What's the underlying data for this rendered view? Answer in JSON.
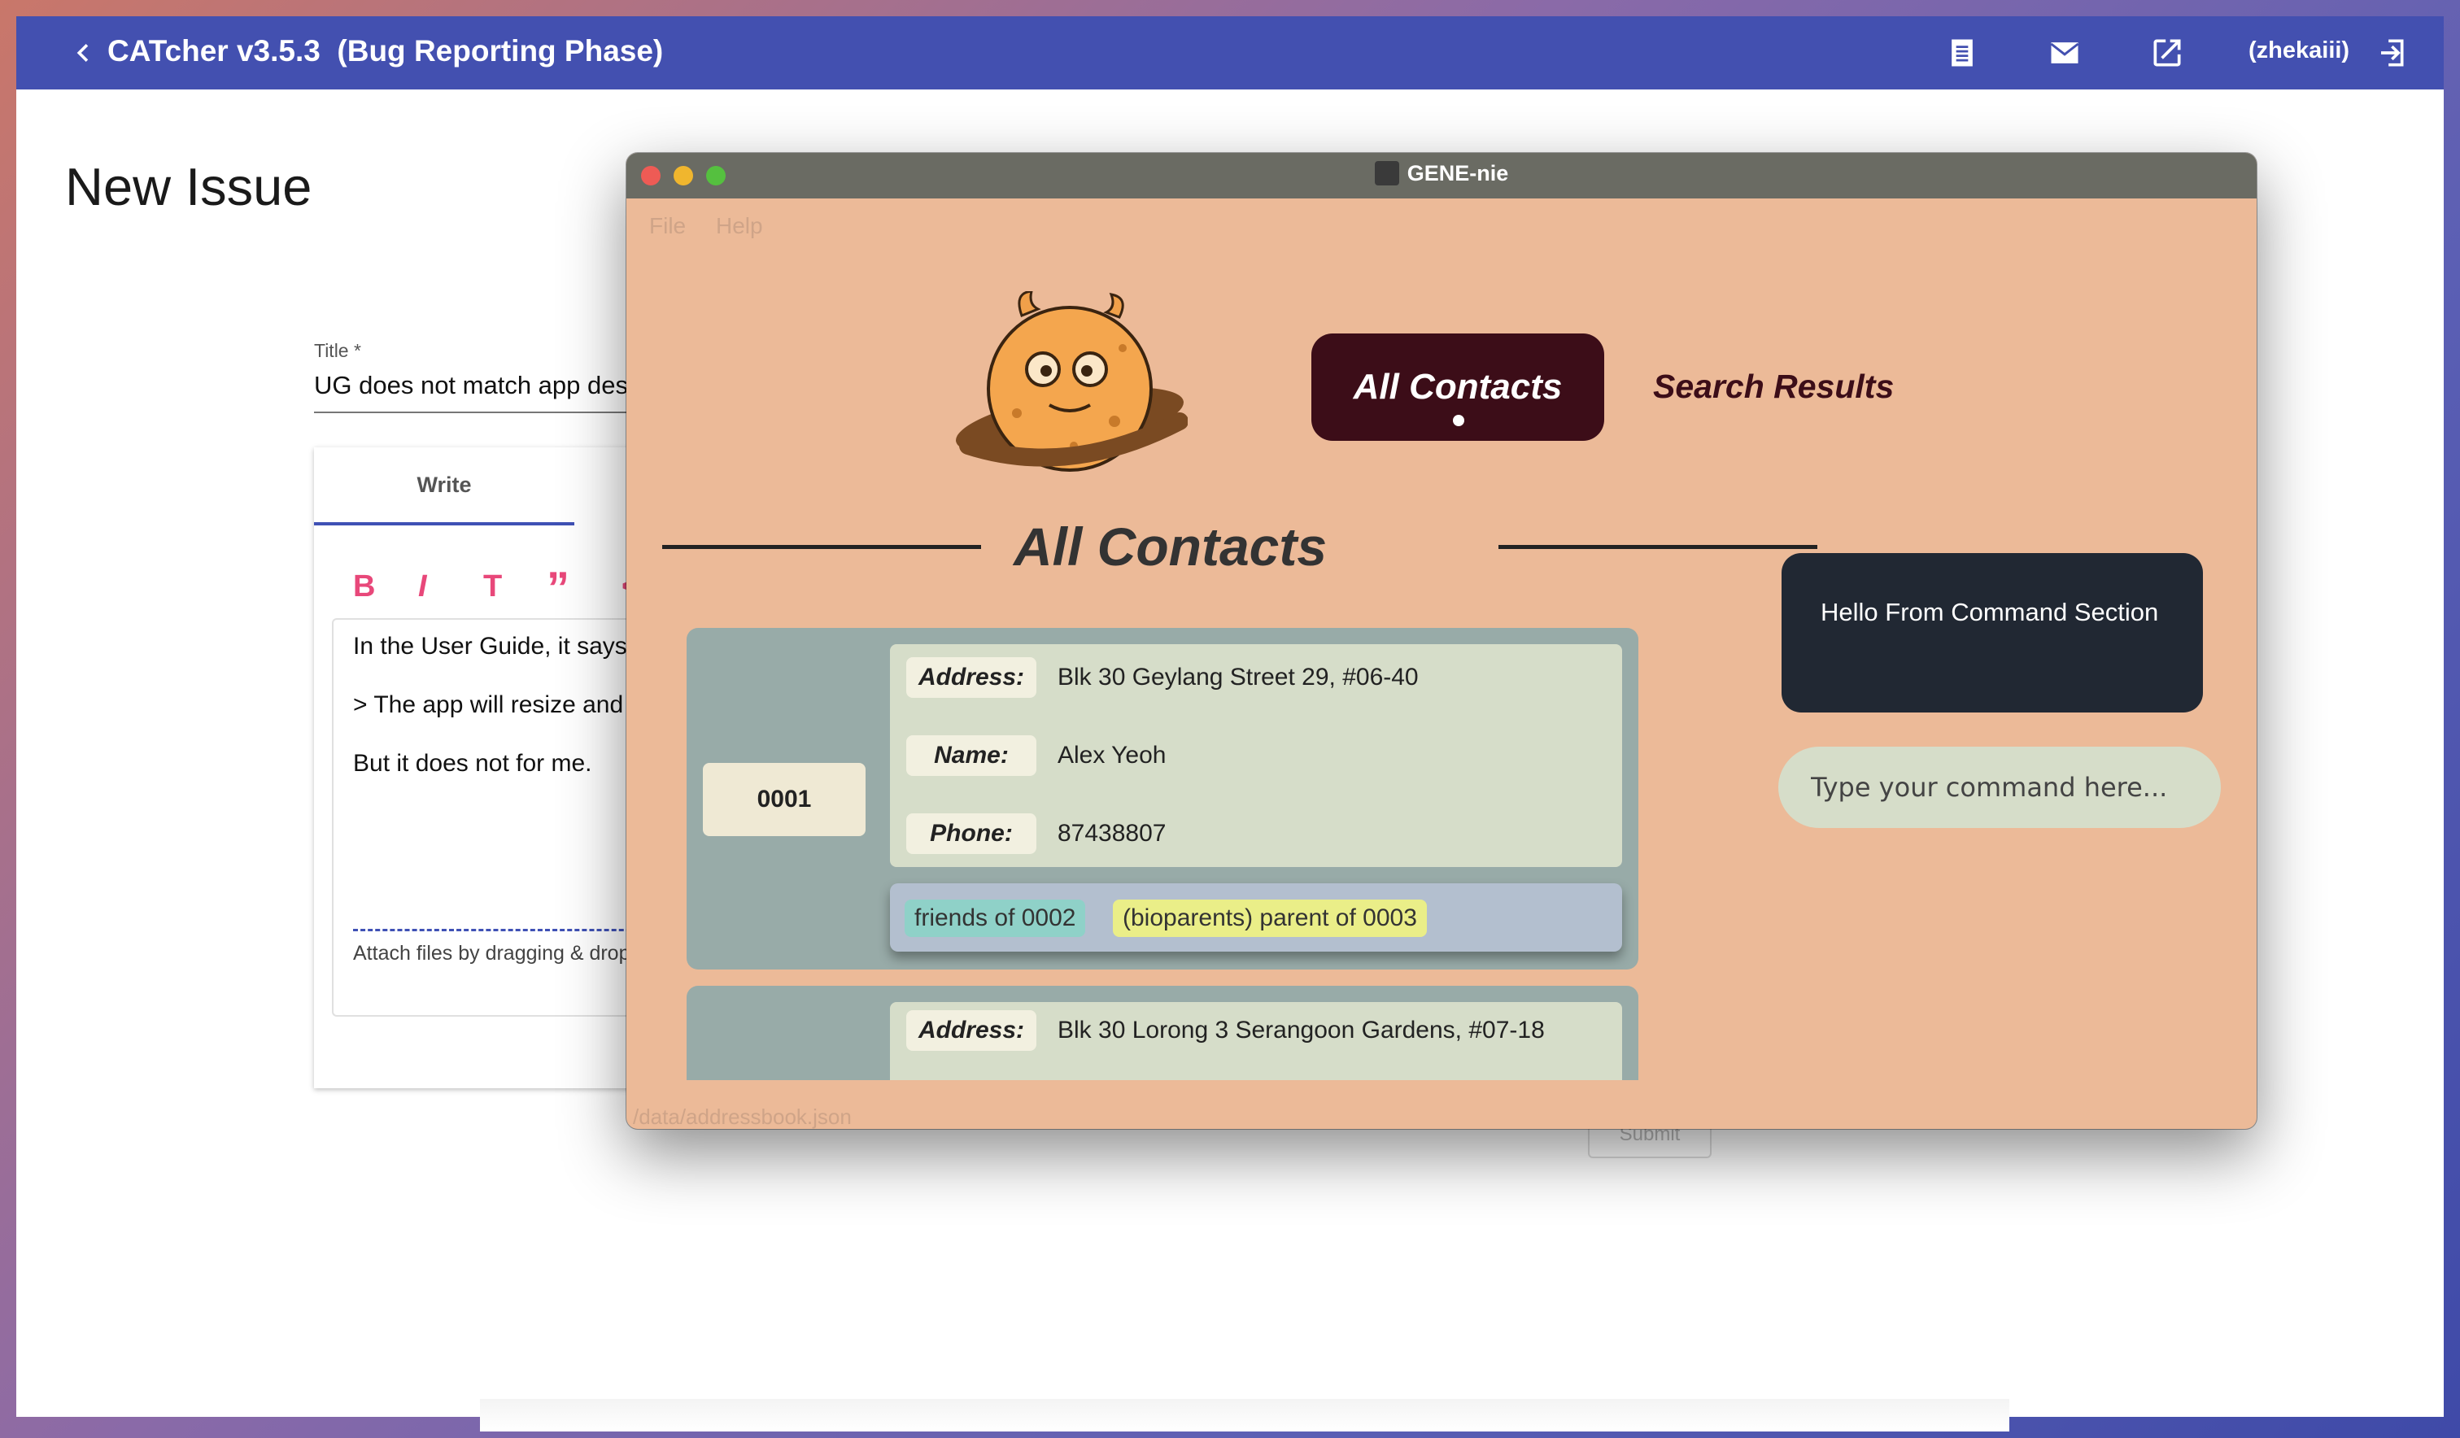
{
  "catcher": {
    "app_title": "CATcher v3.5.3  (Bug Reporting Phase)",
    "user": "(zhekaiii)",
    "page_heading": "New Issue",
    "title_field": {
      "label": "Title *",
      "value": "UG does not match app description"
    },
    "editor": {
      "tab_write": "Write",
      "format_buttons": [
        "B",
        "I",
        "T",
        "”",
        "<"
      ],
      "lines": [
        "In the User Guide, it says",
        "> The app will resize and",
        "But it does not for me."
      ],
      "attach_hint": "Attach files by dragging & drop"
    },
    "submit_label": "Submit",
    "icons": [
      "back-arrow-icon",
      "list-icon",
      "mail-icon",
      "open-in-new-icon",
      "logout-icon"
    ]
  },
  "genie": {
    "window_title": "GENE-nie",
    "menu": [
      "File",
      "Help"
    ],
    "tabs": {
      "all_contacts": "All Contacts",
      "search_results": "Search Results"
    },
    "section_title": "All Contacts",
    "contacts": [
      {
        "id": "0001",
        "fields": [
          {
            "label": "Address:",
            "value": "Blk 30 Geylang Street 29, #06-40"
          },
          {
            "label": "Name:",
            "value": "Alex Yeoh"
          },
          {
            "label": "Phone:",
            "value": "87438807"
          }
        ],
        "relationships": [
          {
            "text": "friends of 0002",
            "color": "#8fd1c8"
          },
          {
            "text": "(bioparents) parent of 0003",
            "color": "#eaee88"
          }
        ]
      },
      {
        "id": "",
        "fields": [
          {
            "label": "Address:",
            "value": "Blk 30 Lorong 3 Serangoon Gardens, #07-18"
          }
        ],
        "relationships": []
      }
    ],
    "command_result": "Hello From Command Section",
    "command_placeholder": "Type your command here...",
    "status_bar": "/data/addressbook.json"
  },
  "colors": {
    "catcher_toolbar": "#4350b0",
    "genie_background": "#ecba98",
    "active_tab": "#3c0d18",
    "card": "#98aba8",
    "command_result_bg": "#212833"
  }
}
